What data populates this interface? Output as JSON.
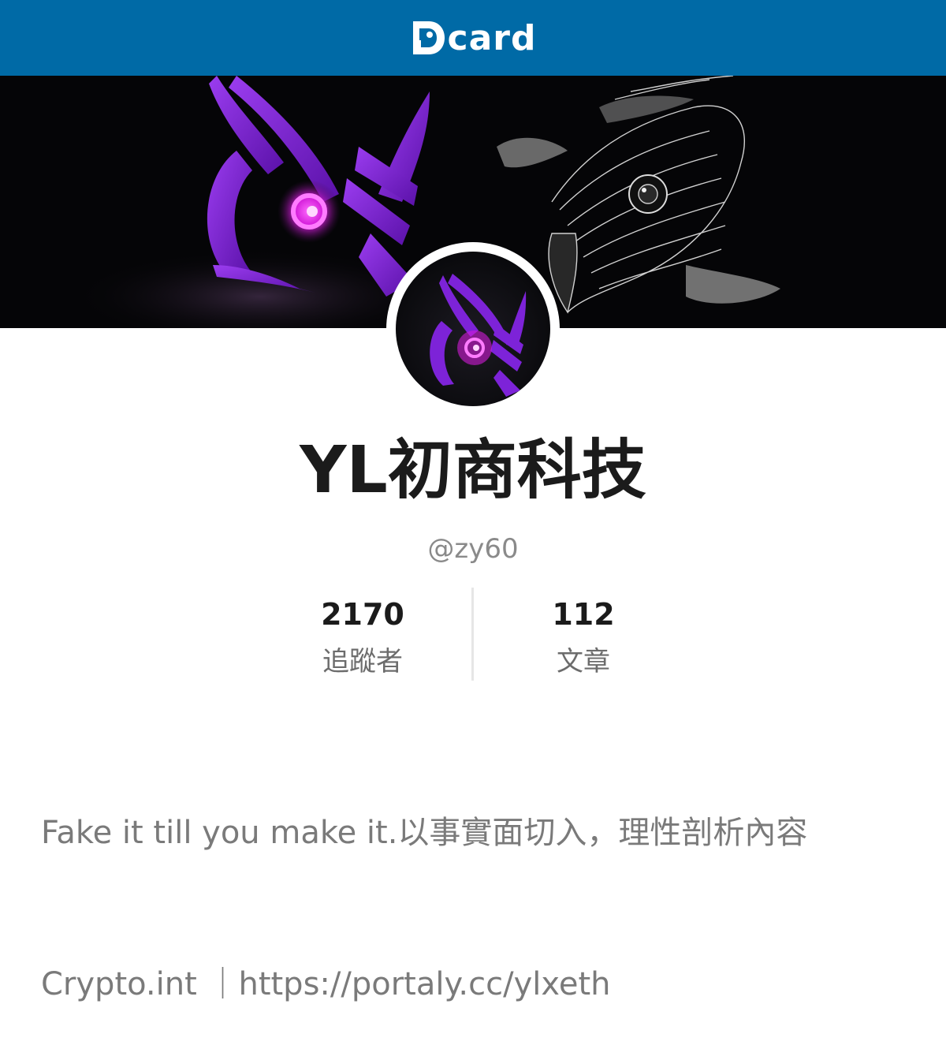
{
  "header": {
    "brand": "card",
    "logo_icon": "dcard-logo-icon",
    "background": "#006aa6"
  },
  "profile": {
    "name": "YL初商科技",
    "handle": "@zy60",
    "stats": [
      {
        "value": "2170",
        "label": "追蹤者"
      },
      {
        "value": "112",
        "label": "文章"
      }
    ],
    "bio_line1": "Fake it till you make it.以事實面切入，理性剖析內容",
    "bio_line2": "Crypto.int ｜https://portaly.cc/ylxeth"
  },
  "colors": {
    "accent": "#006aa6",
    "owl_purple": "#8a2be2",
    "owl_eye": "#ff3df0"
  }
}
